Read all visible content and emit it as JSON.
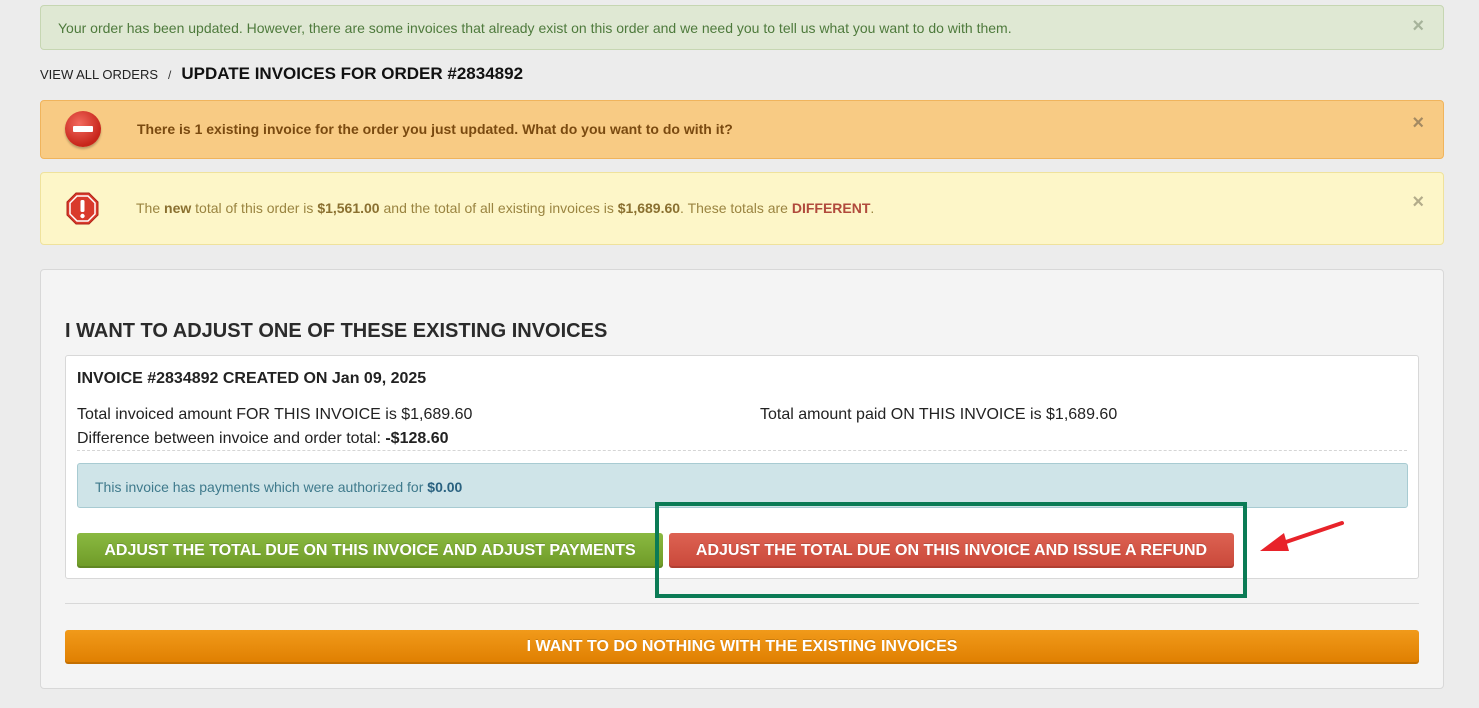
{
  "success_alert": {
    "message": "Your order has been updated. However, there are some invoices that already exist on this order and we need you to tell us what you want to do with them."
  },
  "close_glyph": "×",
  "breadcrumb": {
    "link": "VIEW ALL ORDERS",
    "separator": "/",
    "current": "UPDATE INVOICES FOR ORDER #2834892"
  },
  "danger_alert": {
    "icon": "stop-icon",
    "message": "There is 1 existing invoice for the order you just updated. What do you want to do with it?"
  },
  "warning_alert": {
    "icon": "exclamation-octagon-icon",
    "prefix": "The ",
    "new_word": "new",
    "middle1": " total of this order is ",
    "order_total": "$1,561.00",
    "middle2": " and the total of all existing invoices is ",
    "invoices_total": "$1,689.60",
    "middle3": ". These totals are ",
    "status": "DIFFERENT",
    "suffix": "."
  },
  "section": {
    "title": "I WANT TO ADJUST ONE OF THESE EXISTING INVOICES"
  },
  "invoice": {
    "heading": "INVOICE #2834892 CREATED ON Jan 09, 2025",
    "invoiced_amount": "Total invoiced amount FOR THIS INVOICE is $1,689.60",
    "amount_paid": "Total amount paid ON THIS INVOICE is $1,689.60",
    "difference_label": "Difference between invoice and order total: ",
    "difference_value": "-$128.60",
    "info_text": "This invoice has payments which were authorized for ",
    "info_value": "$0.00",
    "adjust_payments_button": "ADJUST THE TOTAL DUE ON THIS INVOICE AND ADJUST PAYMENTS",
    "issue_refund_button": "ADJUST THE TOTAL DUE ON THIS INVOICE AND ISSUE A REFUND"
  },
  "do_nothing_button": "I WANT TO DO NOTHING WITH THE EXISTING INVOICES",
  "colors": {
    "green_button": "#7aa832",
    "red_button": "#d35546",
    "orange_button": "#e88a0a",
    "highlight": "#0b7b55",
    "arrow": "#e8232a"
  }
}
